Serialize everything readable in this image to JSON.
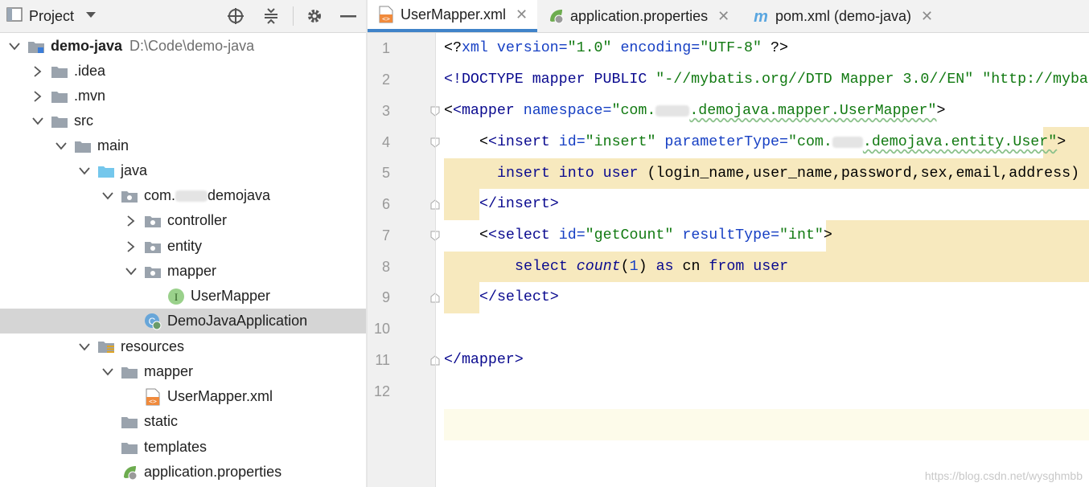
{
  "project_panel": {
    "title": "Project",
    "tree": [
      {
        "label": "demo-java",
        "sub": "D:\\Code\\demo-java",
        "icon": "module-folder-icon",
        "arrow": "down"
      },
      {
        "label": ".idea",
        "icon": "folder-icon",
        "arrow": "right"
      },
      {
        "label": ".mvn",
        "icon": "folder-icon",
        "arrow": "right"
      },
      {
        "label": "src",
        "icon": "folder-icon",
        "arrow": "down"
      },
      {
        "label": "main",
        "icon": "folder-icon",
        "arrow": "down"
      },
      {
        "label": "java",
        "icon": "source-folder-icon",
        "arrow": "down"
      },
      {
        "label_prefix": "com.",
        "label_suffix": "demojava",
        "icon": "package-icon",
        "arrow": "down"
      },
      {
        "label": "controller",
        "icon": "package-icon",
        "arrow": "right"
      },
      {
        "label": "entity",
        "icon": "package-icon",
        "arrow": "right"
      },
      {
        "label": "mapper",
        "icon": "package-icon",
        "arrow": "down"
      },
      {
        "label": "UserMapper",
        "icon": "interface-icon"
      },
      {
        "label": "DemoJavaApplication",
        "icon": "spring-class-icon",
        "selected": true
      },
      {
        "label": "resources",
        "icon": "resources-folder-icon",
        "arrow": "down"
      },
      {
        "label": "mapper",
        "icon": "folder-icon",
        "arrow": "down"
      },
      {
        "label": "UserMapper.xml",
        "icon": "xml-file-icon"
      },
      {
        "label": "static",
        "icon": "folder-icon"
      },
      {
        "label": "templates",
        "icon": "folder-icon"
      },
      {
        "label": "application.properties",
        "icon": "spring-properties-icon"
      }
    ]
  },
  "editor": {
    "tabs": [
      {
        "label": "UserMapper.xml",
        "icon": "xml-file-icon",
        "active": true
      },
      {
        "label": "application.properties",
        "icon": "spring-properties-icon",
        "active": false
      },
      {
        "label": "pom.xml (demo-java)",
        "icon": "maven-icon",
        "active": false
      }
    ],
    "line_numbers": [
      "1",
      "2",
      "3",
      "4",
      "5",
      "6",
      "7",
      "8",
      "9",
      "10",
      "11",
      "12"
    ],
    "code": {
      "l1": {
        "a": "<?",
        "b": "xml",
        "c": " version=",
        "d": "\"1.0\"",
        "e": " encoding=",
        "f": "\"UTF-8\"",
        "g": " ?>"
      },
      "l2": {
        "a": "<!DOCTYPE mapper PUBLIC ",
        "b": "\"-//mybatis.org//DTD Mapper 3.0//EN\"",
        "c": " ",
        "d": "\"http://myba"
      },
      "l3": {
        "a": "<mapper",
        "b": " namespace=",
        "c": "\"com.",
        "d": ".demojava.mapper.UserMapper\"",
        "e": ">"
      },
      "l4": {
        "a": "<insert",
        "b": " id=",
        "c": "\"insert\"",
        "d": " parameterType=",
        "e": "\"com.",
        "f": ".demojava.entity.User\"",
        "g": ">"
      },
      "l5": {
        "a": "insert into user",
        "b": " (login_name,user_name,password,sex,email,address)"
      },
      "l6": {
        "a": "</insert>"
      },
      "l7": {
        "a": "<select",
        "b": " id=",
        "c": "\"getCount\"",
        "d": " resultType=",
        "e": "\"int\"",
        "f": ">"
      },
      "l8": {
        "a": "select ",
        "b": "count",
        "c": "(",
        "d": "1",
        "e": ") ",
        "f": "as",
        "g": " cn ",
        "h": "from user"
      },
      "l9": {
        "a": "</select>"
      },
      "l11": {
        "a": "</mapper>"
      }
    }
  },
  "watermark": "https://blog.csdn.net/wysghmbb",
  "colors": {
    "accent": "#4083c9",
    "selection": "#d5d5d5",
    "sql_highlight": "#f7e9be"
  }
}
